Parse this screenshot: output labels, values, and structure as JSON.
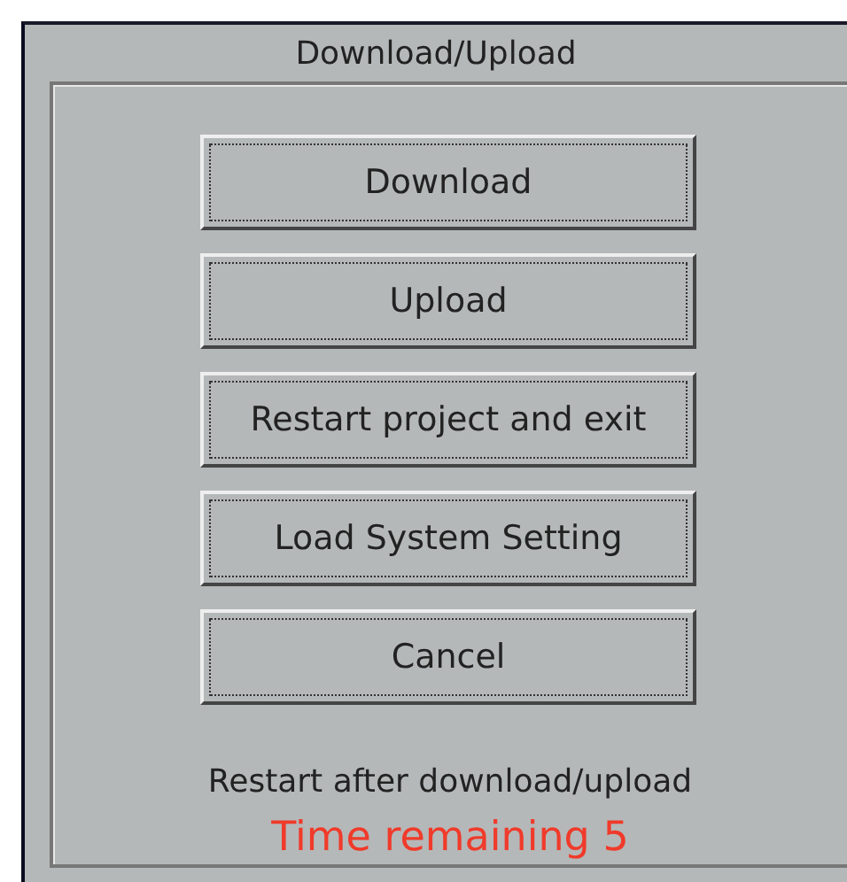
{
  "window": {
    "title": "Download/Upload"
  },
  "buttons": [
    {
      "label": "Download"
    },
    {
      "label": "Upload"
    },
    {
      "label": "Restart project and exit"
    },
    {
      "label": "Load System Setting"
    },
    {
      "label": "Cancel"
    }
  ],
  "message": "Restart after download/upload",
  "countdown": "Time remaining 5"
}
